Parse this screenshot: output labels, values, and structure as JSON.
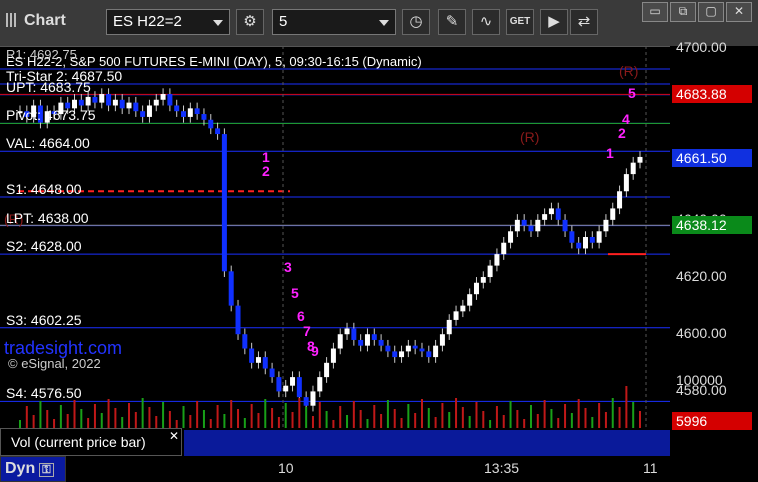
{
  "toolbar": {
    "title": "Chart",
    "symbol": "ES H22=2",
    "interval": "5",
    "get_label": "GET",
    "window_buttons": [
      "▭",
      "⧉",
      "▢",
      "✕"
    ]
  },
  "chart": {
    "header": "ES H22-2, S&P 500 FUTURES E-MINI (DAY), 5, 09:30-16:15 (Dynamic)",
    "header_top": "R1: 4692.75",
    "levels": [
      {
        "label": "Tri-Star 2: 4687.50"
      },
      {
        "label": "UPT: 4683.75"
      },
      {
        "label": "Pivot: 4673.75"
      },
      {
        "label": "VAL: 4664.00"
      },
      {
        "label": "S1: 4648.00"
      },
      {
        "label": "LPT: 4638.00"
      },
      {
        "label": "S2: 4628.00"
      },
      {
        "label": "S3: 4602.25"
      },
      {
        "label": "S4: 4576.50"
      }
    ],
    "watermark": "tradesight.com",
    "copyright": "© eSignal, 2022",
    "markers_R": [
      "(R)",
      "(R)",
      "(R)"
    ],
    "price_tags": [
      {
        "value": "4683.88",
        "color": "#d40000"
      },
      {
        "value": "4661.50",
        "color": "#1030e0"
      },
      {
        "value": "4638.12",
        "color": "#0a8a1a"
      }
    ],
    "y_labels": [
      "4700.00",
      "4660.00",
      "4640.00",
      "4620.00",
      "4600.00",
      "4580.00"
    ],
    "colors": {
      "up": "#ffffff",
      "down": "#1030ff",
      "pivot_green": "#1fa81f",
      "counter": "#ff22ff",
      "setup": "#1a9a1a"
    },
    "chart_data": {
      "type": "candlestick",
      "title": "ES H22-2, S&P 500 FUTURES E-MINI (DAY), 5, 09:30-16:15 (Dynamic)",
      "y_range": [
        4570,
        4705
      ],
      "x_labels": [
        "10",
        "13:35",
        "11"
      ],
      "counters": [
        "1",
        "2",
        "3",
        "5",
        "6",
        "7",
        "8",
        "9",
        "1",
        "2",
        "3",
        "4",
        "5"
      ]
    }
  },
  "volume": {
    "label": "Vol (current price bar)",
    "close_label": "✕",
    "y_max_label": "100000",
    "last_value": "5996",
    "last_color": "#d40000"
  },
  "x_axis": {
    "labels": [
      "10",
      "13:35",
      "11"
    ]
  },
  "bottom": {
    "dyn_label": "Dyn"
  }
}
